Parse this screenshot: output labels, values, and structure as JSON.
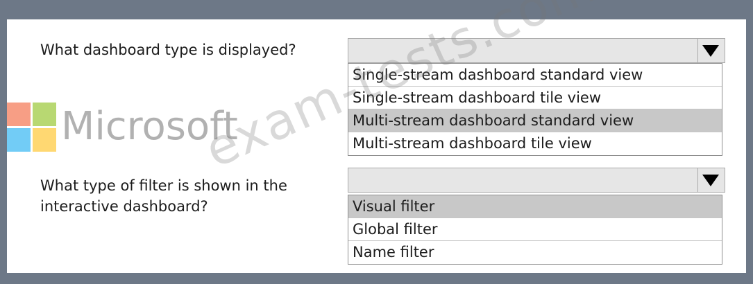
{
  "questions": [
    {
      "text": "What dashboard type is displayed?",
      "options": [
        "Single-stream dashboard standard view",
        "Single-stream dashboard tile view",
        "Multi-stream dashboard standard view",
        "Multi-stream dashboard tile view"
      ],
      "selected_index": 2
    },
    {
      "text": "What type of filter is shown in the interactive dashboard?",
      "options": [
        "Visual filter",
        "Global filter",
        "Name filter"
      ],
      "selected_index": 0
    }
  ],
  "logo": {
    "text": "Microsoft"
  },
  "watermark": {
    "text": "exam-tests.com"
  },
  "colors": {
    "frame": "#6d7887",
    "selected_row": "#c8c8c8",
    "header_fill": "#e6e6e6"
  }
}
